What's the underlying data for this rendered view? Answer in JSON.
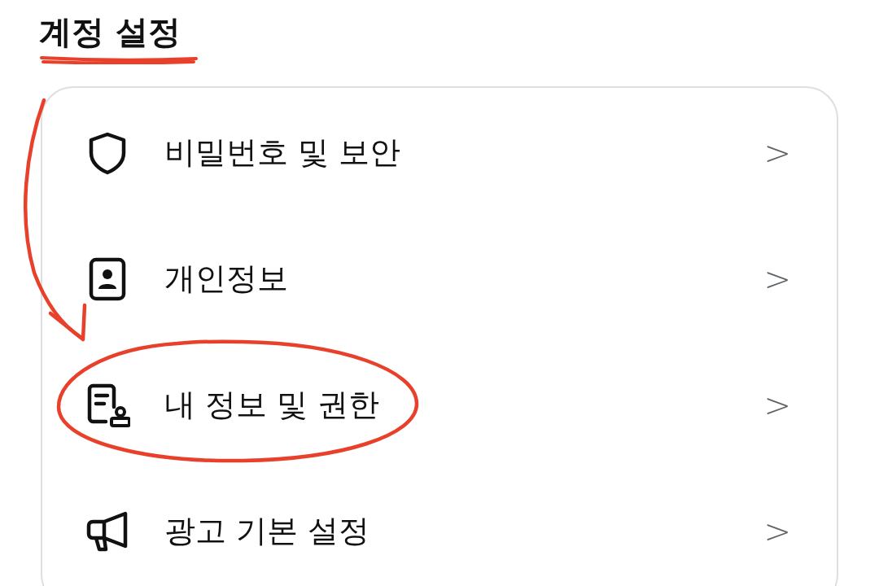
{
  "title": {
    "text": "계정 설정",
    "underlined": true
  },
  "items": [
    {
      "kind": "shield",
      "label": "비밀번호 및 보안",
      "chevron": ">",
      "highlighted": false
    },
    {
      "kind": "idcard",
      "label": "개인정보",
      "chevron": ">",
      "highlighted": false
    },
    {
      "kind": "document",
      "label": "내 정보 및 권한",
      "chevron": ">",
      "highlighted": true
    },
    {
      "kind": "megaphone",
      "label": "광고 기본 설정",
      "chevron": ">",
      "highlighted": false
    }
  ]
}
